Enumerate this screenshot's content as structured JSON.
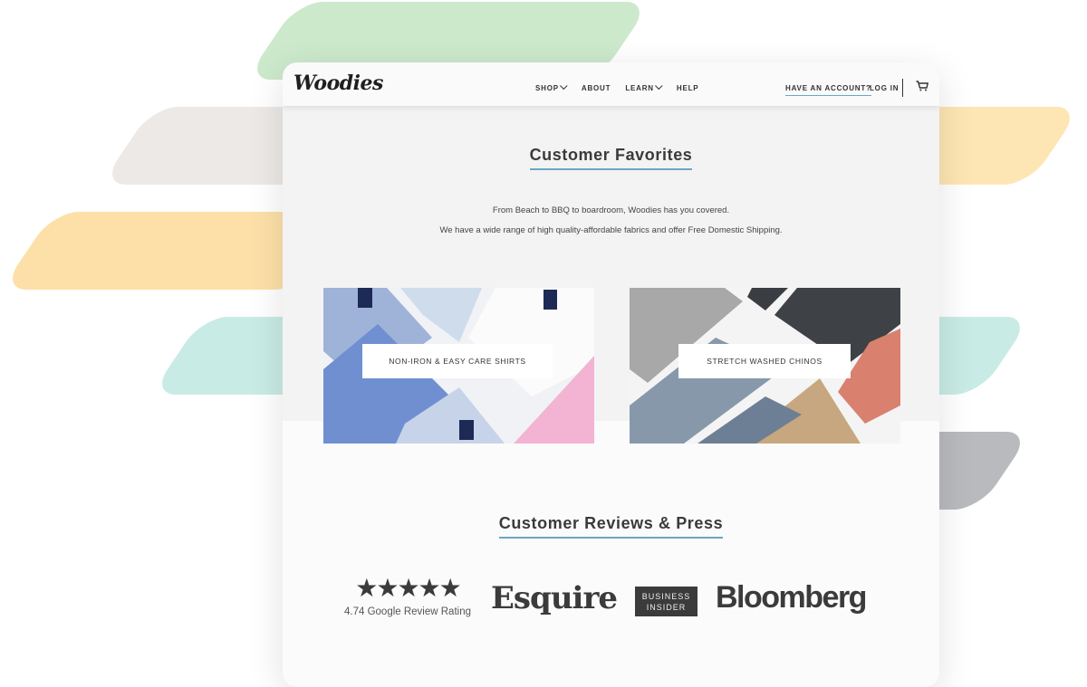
{
  "brand": {
    "logo": "Woodies"
  },
  "nav": {
    "links": [
      {
        "label": "SHOP",
        "has_dropdown": true
      },
      {
        "label": "ABOUT",
        "has_dropdown": false
      },
      {
        "label": "LEARN",
        "has_dropdown": true
      },
      {
        "label": "HELP",
        "has_dropdown": false
      }
    ],
    "account": "HAVE AN ACCOUNT?",
    "login": "LOG IN",
    "cart_icon": "cart-icon"
  },
  "favorites": {
    "title": "Customer Favorites",
    "subtitle_1": "From Beach to BBQ to boardroom, Woodies has you covered.",
    "subtitle_2": "We have a wide range of high quality-affordable fabrics and offer Free Domestic Shipping.",
    "tiles": [
      {
        "label": "NON-IRON & EASY CARE SHIRTS"
      },
      {
        "label": "STRETCH WASHED CHINOS"
      }
    ]
  },
  "reviews": {
    "title": "Customer Reviews & Press",
    "rating_text": "4.74 Google Review Rating",
    "rating_stars": 4.74,
    "press": {
      "esquire": "Esquire",
      "business_insider": "BUSINESS INSIDER",
      "bloomberg": "Bloomberg"
    }
  },
  "colors": {
    "accent_underline": "#6aa7c6",
    "logo_text": "#3b3b3b"
  }
}
